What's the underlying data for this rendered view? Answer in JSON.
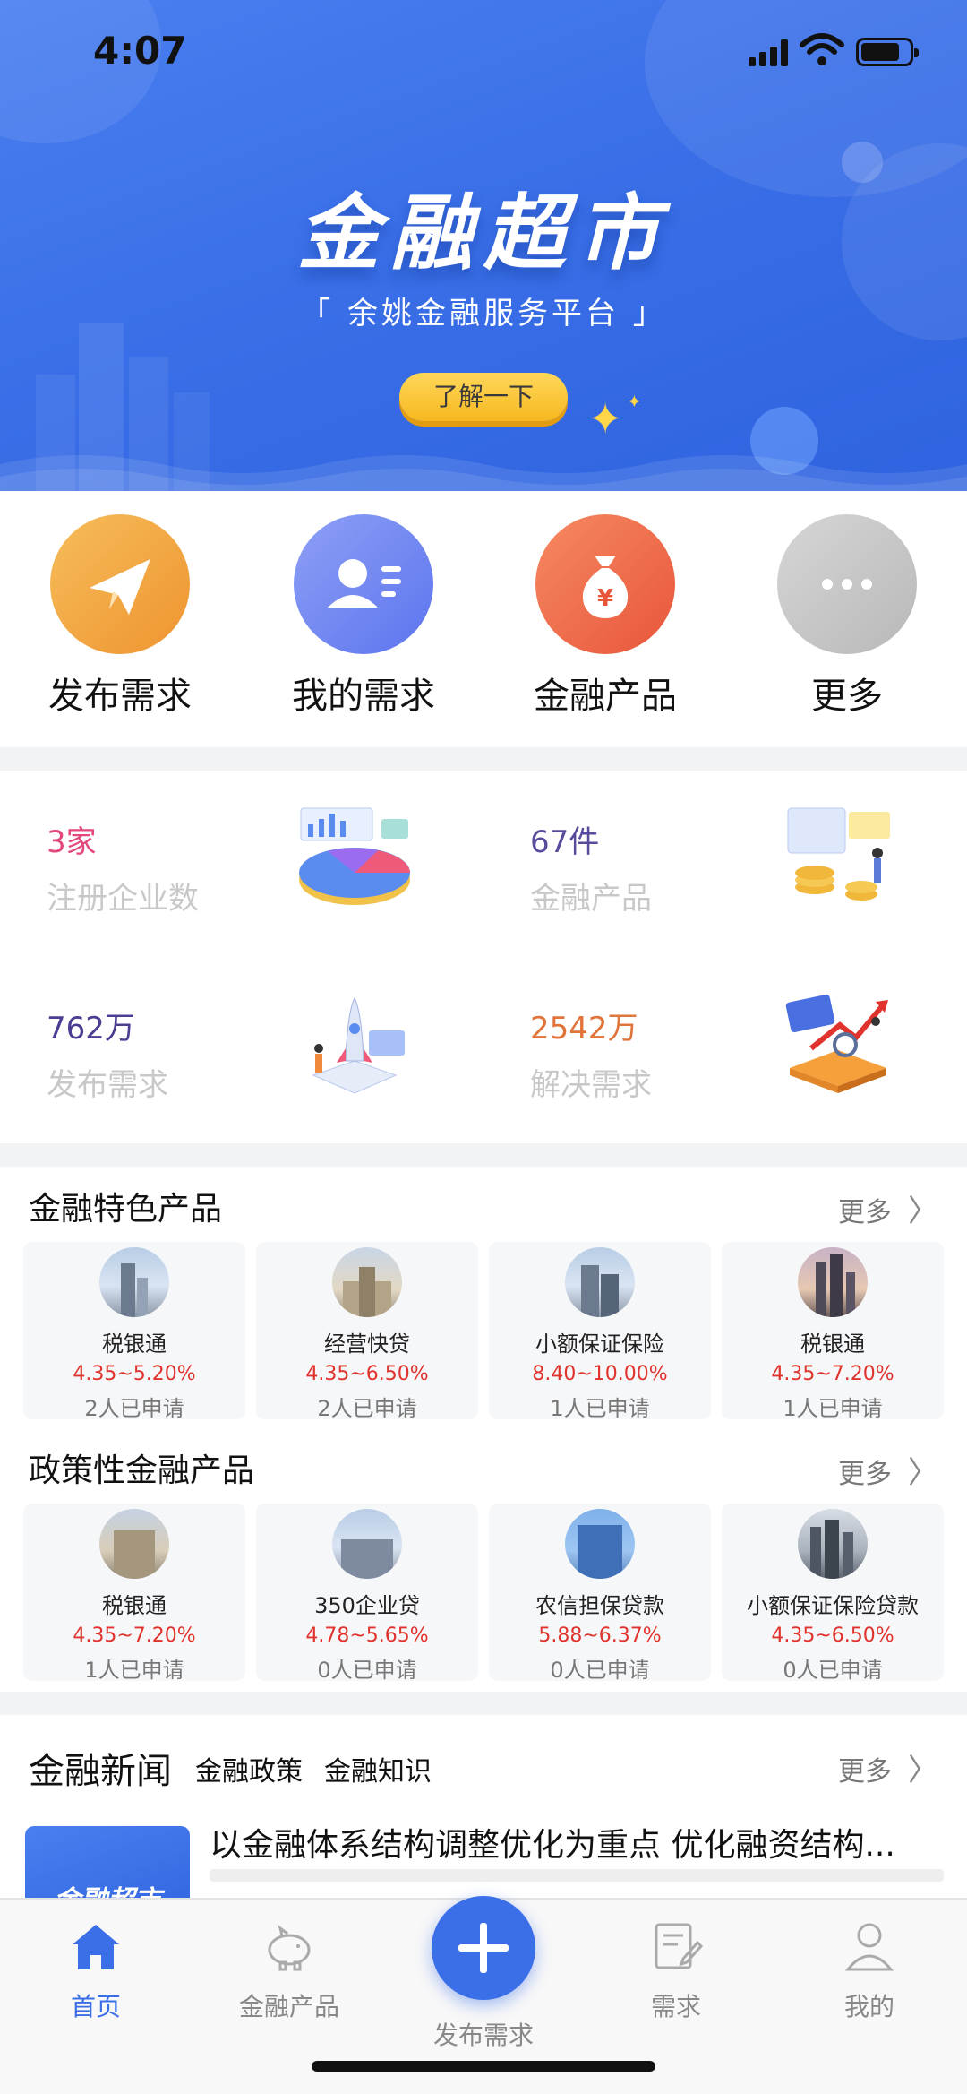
{
  "status_bar": {
    "time": "4:07"
  },
  "hero": {
    "title": "金融超市",
    "subtitle": "「 余姚金融服务平台 」",
    "button_label": "了解一下"
  },
  "quick_actions": [
    {
      "label": "发布需求",
      "icon": "paper-plane-icon",
      "color": "#f0a23a"
    },
    {
      "label": "我的需求",
      "icon": "user-card-icon",
      "color": "#6c83f0"
    },
    {
      "label": "金融产品",
      "icon": "money-bag-icon",
      "color": "#ef6a4a"
    },
    {
      "label": "更多",
      "icon": "more-dots-icon",
      "color": "#c4c4c4"
    }
  ],
  "stats": [
    {
      "value": "3家",
      "label": "注册企业数",
      "color": "#e3477e"
    },
    {
      "value": "67件",
      "label": "金融产品",
      "color": "#5a4a9c"
    },
    {
      "value": "762万",
      "label": "发布需求",
      "color": "#4b3d92"
    },
    {
      "value": "2542万",
      "label": "解决需求",
      "color": "#e0743a"
    }
  ],
  "featured": {
    "title": "金融特色产品",
    "more": "更多",
    "items": [
      {
        "name": "税银通",
        "rate": "4.35~5.20%",
        "applied": "2人已申请"
      },
      {
        "name": "经营快贷",
        "rate": "4.35~6.50%",
        "applied": "2人已申请"
      },
      {
        "name": "小额保证保险",
        "rate": "8.40~10.00%",
        "applied": "1人已申请"
      },
      {
        "name": "税银通",
        "rate": "4.35~7.20%",
        "applied": "1人已申请"
      }
    ]
  },
  "policy": {
    "title": "政策性金融产品",
    "more": "更多",
    "items": [
      {
        "name": "税银通",
        "rate": "4.35~7.20%",
        "applied": "1人已申请"
      },
      {
        "name": "350企业贷",
        "rate": "4.78~5.65%",
        "applied": "0人已申请"
      },
      {
        "name": "农信担保贷款",
        "rate": "5.88~6.37%",
        "applied": "0人已申请"
      },
      {
        "name": "小额保证保险贷款",
        "rate": "4.35~6.50%",
        "applied": "0人已申请"
      }
    ]
  },
  "news": {
    "title": "金融新闻",
    "tabs": [
      "金融政策",
      "金融知识"
    ],
    "more": "更多",
    "headline": "以金融体系结构调整优化为重点  优化融资结构...",
    "thumb_text": "金融超市"
  },
  "tabbar": {
    "items": [
      {
        "label": "首页",
        "icon": "home-icon"
      },
      {
        "label": "金融产品",
        "icon": "piggy-bank-icon"
      },
      {
        "label": "需求",
        "icon": "edit-document-icon"
      },
      {
        "label": "我的",
        "icon": "person-icon"
      }
    ],
    "center_label": "发布需求"
  },
  "colors": {
    "brand": "#3a6fe8",
    "rate_red": "#e0332e"
  }
}
